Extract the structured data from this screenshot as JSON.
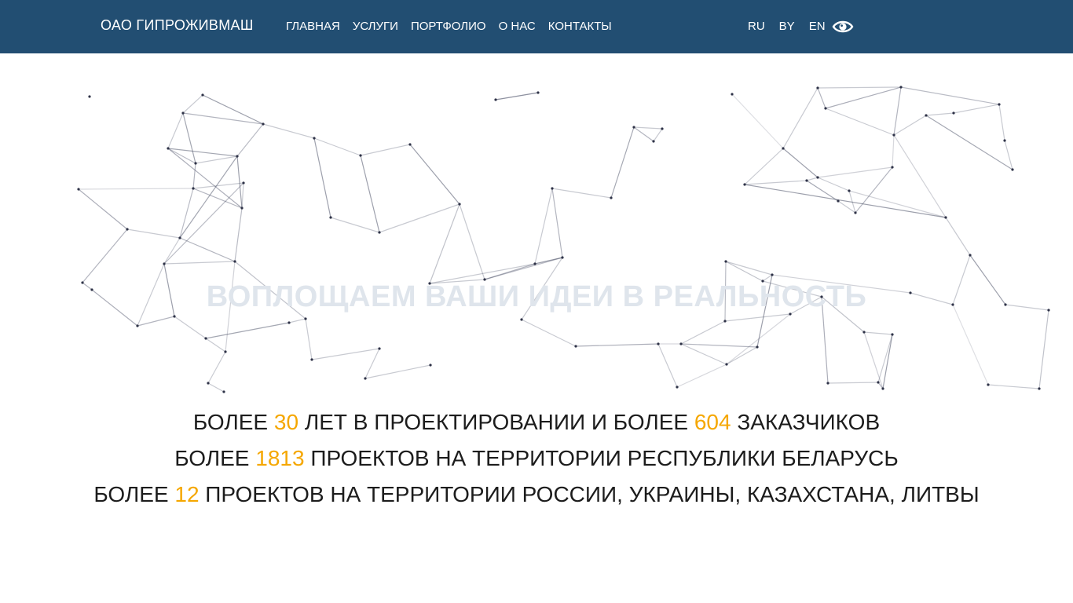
{
  "header": {
    "brand": "ОАО ГИПРОЖИВМАШ",
    "nav": [
      "ГЛАВНАЯ",
      "УСЛУГИ",
      "ПОРТФОЛИО",
      "О НАС",
      "КОНТАКТЫ"
    ],
    "languages": [
      "RU",
      "BY",
      "EN"
    ],
    "accessibility_icon": "eye-icon",
    "background_color": "#224e72"
  },
  "hero": {
    "tagline": "ВОПЛОЩАЕМ ВАШИ ИДЕИ В РЕАЛЬНОСТЬ",
    "network_line_color": "#4a4f66",
    "network_node_color": "#2e3247"
  },
  "stats": [
    {
      "pre": "БОЛЕЕ ",
      "n1": "30",
      "mid": " ЛЕТ В ПРОЕКТИРОВАНИИ И БОЛЕЕ ",
      "n2": "604",
      "post": " ЗАКАЗЧИКОВ"
    },
    {
      "pre": "БОЛЕЕ ",
      "n1": "1813",
      "mid": " ПРОЕКТОВ НА ТЕРРИТОРИИ РЕСПУБЛИКИ БЕЛАРУСЬ",
      "n2": "",
      "post": ""
    },
    {
      "pre": "БОЛЕЕ ",
      "n1": "12",
      "mid": " ПРОЕКТОВ НА ТЕРРИТОРИИ РОССИИ, УКРАИНЫ, КАЗАХСТАНА, ЛИТВЫ",
      "n2": "",
      "post": ""
    }
  ],
  "accent_color": "#f5a700"
}
